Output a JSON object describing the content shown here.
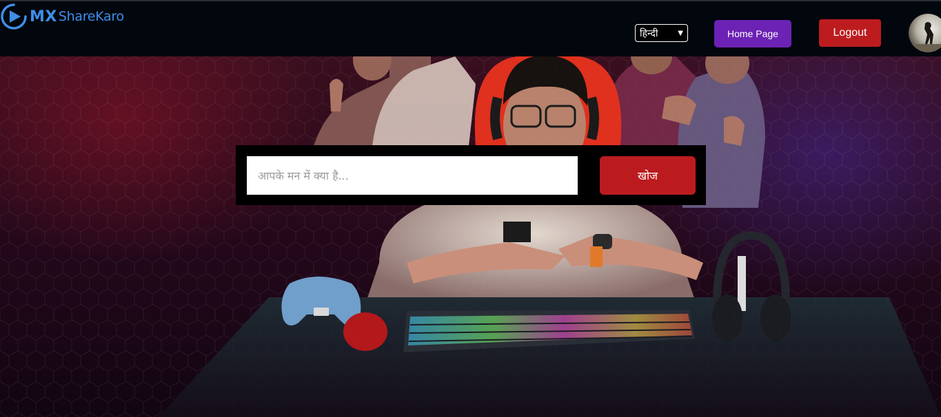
{
  "brand": {
    "mx": "MX",
    "name": "ShareKaro",
    "color": "#3f8ee8"
  },
  "navbar": {
    "language_selected": "हिन्दी",
    "home_label": "Home Page",
    "logout_label": "Logout",
    "home_color": "#6c22b4",
    "logout_color": "#bd1c1f"
  },
  "search": {
    "placeholder": "आपके मन में क्या है...",
    "button_label": "खोज",
    "button_color": "#bb1b1f"
  },
  "icons": {
    "logo": "play-circle-icon",
    "dropdown": "chevron-down-icon"
  }
}
